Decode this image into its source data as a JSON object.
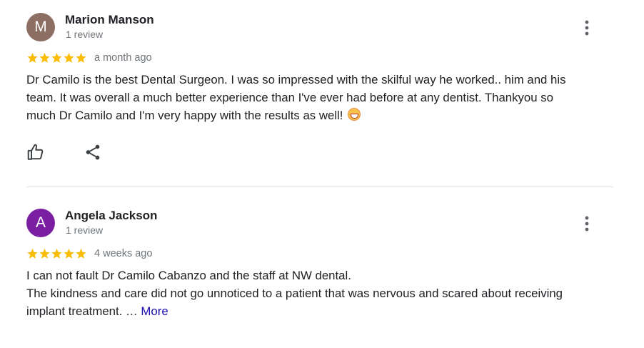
{
  "reviews": [
    {
      "avatar_letter": "M",
      "avatar_color": "#8d6e63",
      "author": "Marion Manson",
      "meta": "1 review",
      "rating": 5,
      "time": "a month ago",
      "text_lines": [
        "Dr Camilo is the best Dental Surgeon. I was so impressed with the skilful way he worked.. him and his",
        "team. It was overall a much better experience than I've ever had before at any dentist. Thankyou so",
        "much Dr Camilo and I'm very happy with the results as well!"
      ],
      "emoji_icon": "grinning-face-emoji-icon"
    },
    {
      "avatar_letter": "A",
      "avatar_color": "#7b1fa2",
      "author": "Angela Jackson",
      "meta": "1 review",
      "rating": 5,
      "time": "4 weeks ago",
      "text_lines": [
        "I can not fault Dr Camilo Cabanzo and the staff at NW dental.",
        "The kindness and care did not go unnoticed to a patient that was nervous and scared about receiving",
        "implant treatment. … "
      ],
      "more_label": "More"
    }
  ],
  "colors": {
    "star": "#fbbc04",
    "link": "#1a0dab",
    "icon": "#5f6368",
    "meta": "#70757a"
  }
}
